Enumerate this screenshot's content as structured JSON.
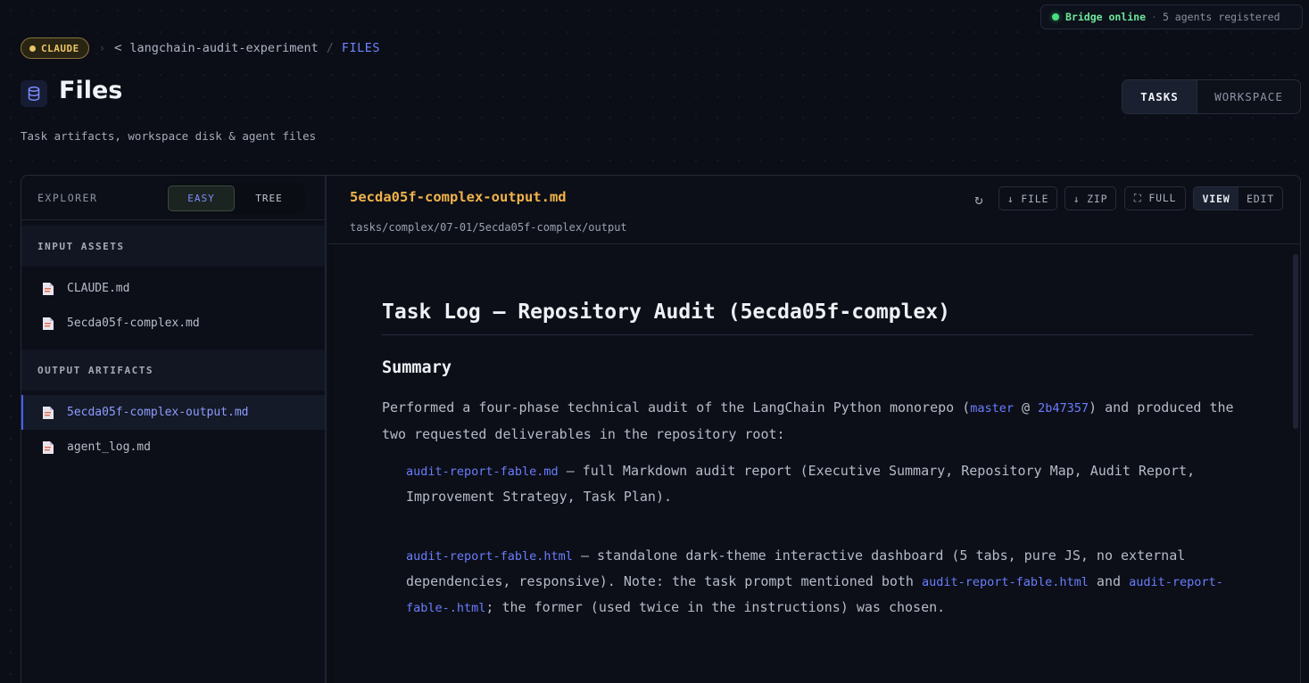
{
  "status": {
    "online_label": "Bridge online",
    "separator": "·",
    "agents_label": "5 agents registered"
  },
  "breadcrumb": {
    "badge": "CLAUDE",
    "separator": "›",
    "back_glyph": "<",
    "project": "langchain-audit-experiment",
    "slash": "/",
    "current": "FILES"
  },
  "header": {
    "title": "Files",
    "subtitle": "Task artifacts, workspace disk & agent files",
    "tabs": [
      {
        "label": "TASKS",
        "active": true
      },
      {
        "label": "WORKSPACE",
        "active": false
      }
    ]
  },
  "sidebar": {
    "title": "EXPLORER",
    "modes": [
      {
        "label": "EASY",
        "active": true
      },
      {
        "label": "TREE",
        "active": false
      }
    ],
    "sections": [
      {
        "title": "INPUT ASSETS",
        "files": [
          {
            "name": "CLAUDE.md"
          },
          {
            "name": "5ecda05f-complex.md"
          }
        ]
      },
      {
        "title": "OUTPUT ARTIFACTS",
        "files": [
          {
            "name": "5ecda05f-complex-output.md",
            "active": true
          },
          {
            "name": "agent_log.md"
          }
        ]
      }
    ]
  },
  "viewer": {
    "filename": "5ecda05f-complex-output.md",
    "path": "tasks/complex/07-01/5ecda05f-complex/output",
    "refresh_glyph": "↻",
    "buttons": {
      "file": "↓ FILE",
      "zip": "↓ ZIP",
      "full": "⛶ FULL"
    },
    "modes": [
      {
        "label": "VIEW",
        "active": true
      },
      {
        "label": "EDIT",
        "active": false
      }
    ]
  },
  "document": {
    "h1": "Task Log — Repository Audit (5ecda05f-complex)",
    "h2": "Summary",
    "p1": {
      "a": "Performed a four-phase technical audit of the LangChain Python monorepo (",
      "branch": "master",
      "at": " @ ",
      "commit": "2b47357",
      "b": ") and produced the two requested deliverables in the repository root:"
    },
    "item1": {
      "link": "audit-report-fable.md",
      "text": " — full Markdown audit report (Executive Summary, Repository Map, Audit Report, Improvement Strategy, Task Plan)."
    },
    "item2": {
      "link": "audit-report-fable.html",
      "text": " — standalone dark-theme interactive dashboard (5 tabs, pure JS, no external dependencies, responsive). Note: the task prompt mentioned both ",
      "link2": "audit-report-fable.html",
      "and": " and ",
      "link3": "audit-report-fable-.html",
      "text2": "; the former (used twice in the instructions) was chosen."
    }
  },
  "colors": {
    "accent": "#6e84ff",
    "filename": "#f0b24a",
    "badge": "#e8c566",
    "online": "#4ade80",
    "link": "#6a7dfd"
  }
}
